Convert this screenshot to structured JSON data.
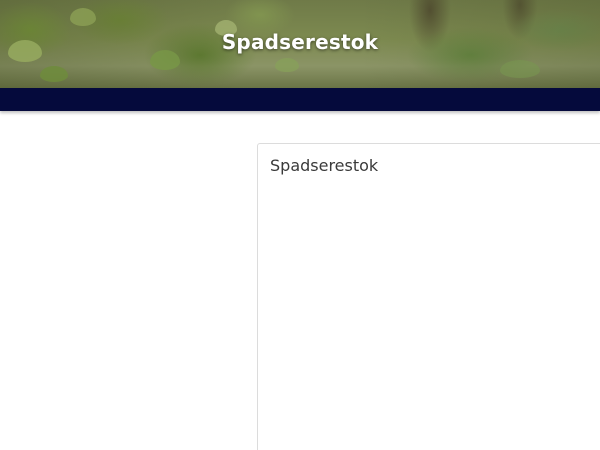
{
  "hero": {
    "title": "Spadserestok"
  },
  "card": {
    "title": "Spadserestok"
  },
  "colors": {
    "navbar": "#050a3c",
    "hero_text": "#ffffff",
    "card_title": "#3a3a3a",
    "card_border": "#dcdcdc"
  }
}
